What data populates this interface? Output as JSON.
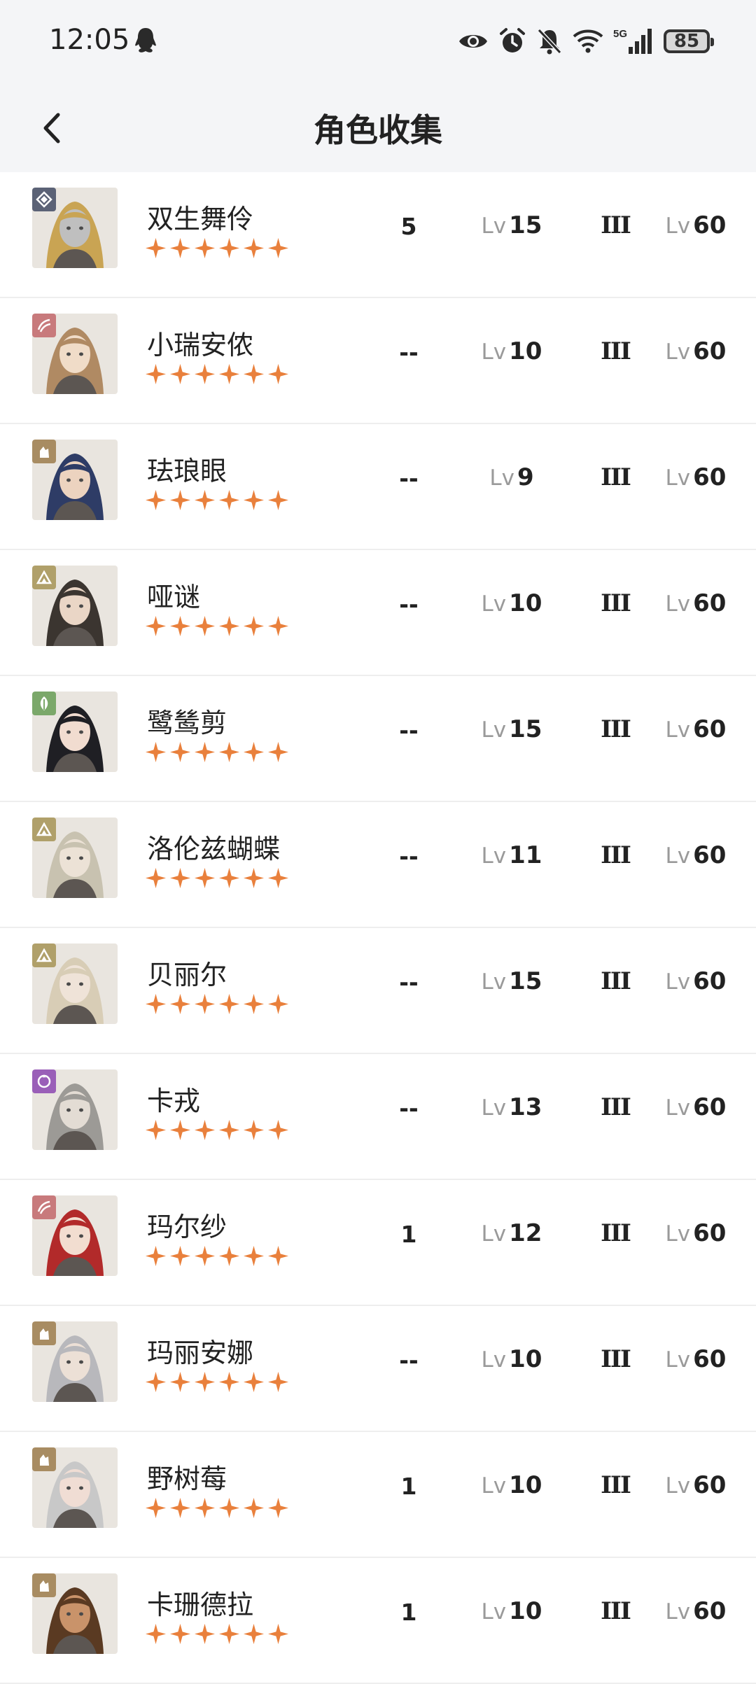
{
  "status_bar": {
    "time": "12:05",
    "battery": "85",
    "network": "5G",
    "icons": [
      "qq-icon",
      "eye-icon",
      "alarm-icon",
      "mute-icon",
      "wifi-icon",
      "signal-icon",
      "battery-icon"
    ]
  },
  "app_bar": {
    "title": "角色收集",
    "back_icon": "chevron-left-icon"
  },
  "colors": {
    "star": "#e9803c",
    "background_header": "#f4f5f7",
    "divider": "#eeeeee"
  },
  "characters": [
    {
      "name": "双生舞伶",
      "stars": 6,
      "count": "5",
      "lv_label": "Lv",
      "level": "15",
      "rank": "III",
      "max_label": "Lv",
      "max_level": "60",
      "element": "purple-diamond",
      "badge_color": "#5b6276",
      "hair": "#c9a453",
      "skin": "#bfbfbf"
    },
    {
      "name": "小瑞安侬",
      "stars": 6,
      "count": "--",
      "lv_label": "Lv",
      "level": "10",
      "rank": "III",
      "max_label": "Lv",
      "max_level": "60",
      "element": "wind",
      "badge_color": "#c87a7c",
      "hair": "#b08a63",
      "skin": "#f0dcc8"
    },
    {
      "name": "珐琅眼",
      "stars": 6,
      "count": "--",
      "lv_label": "Lv",
      "level": "9",
      "rank": "III",
      "max_label": "Lv",
      "max_level": "60",
      "element": "beast",
      "badge_color": "#a88c62",
      "hair": "#2e3c66",
      "skin": "#ecd3bf"
    },
    {
      "name": "哑谜",
      "stars": 6,
      "count": "--",
      "lv_label": "Lv",
      "level": "10",
      "rank": "III",
      "max_label": "Lv",
      "max_level": "60",
      "element": "rock",
      "badge_color": "#b0a06a",
      "hair": "#3b3530",
      "skin": "#ead6c6"
    },
    {
      "name": "鹭鸶剪",
      "stars": 6,
      "count": "--",
      "lv_label": "Lv",
      "level": "15",
      "rank": "III",
      "max_label": "Lv",
      "max_level": "60",
      "element": "plant",
      "badge_color": "#7ba86a",
      "hair": "#1f1f24",
      "skin": "#f1dcd0"
    },
    {
      "name": "洛伦兹蝴蝶",
      "stars": 6,
      "count": "--",
      "lv_label": "Lv",
      "level": "11",
      "rank": "III",
      "max_label": "Lv",
      "max_level": "60",
      "element": "rock",
      "badge_color": "#b0a06a",
      "hair": "#c8c2b0",
      "skin": "#ece2d6"
    },
    {
      "name": "贝丽尔",
      "stars": 6,
      "count": "--",
      "lv_label": "Lv",
      "level": "15",
      "rank": "III",
      "max_label": "Lv",
      "max_level": "60",
      "element": "rock",
      "badge_color": "#b0a06a",
      "hair": "#d8cdb6",
      "skin": "#efe3d8"
    },
    {
      "name": "卡戎",
      "stars": 6,
      "count": "--",
      "lv_label": "Lv",
      "level": "13",
      "rank": "III",
      "max_label": "Lv",
      "max_level": "60",
      "element": "star",
      "badge_color": "#9a5fb8",
      "hair": "#9c9a96",
      "skin": "#e3dcd4"
    },
    {
      "name": "玛尔纱",
      "stars": 6,
      "count": "1",
      "lv_label": "Lv",
      "level": "12",
      "rank": "III",
      "max_label": "Lv",
      "max_level": "60",
      "element": "wind",
      "badge_color": "#c87a7c",
      "hair": "#b22a2a",
      "skin": "#f2ddd0"
    },
    {
      "name": "玛丽安娜",
      "stars": 6,
      "count": "--",
      "lv_label": "Lv",
      "level": "10",
      "rank": "III",
      "max_label": "Lv",
      "max_level": "60",
      "element": "beast",
      "badge_color": "#a88c62",
      "hair": "#b8b8bc",
      "skin": "#ece0d6"
    },
    {
      "name": "野树莓",
      "stars": 6,
      "count": "1",
      "lv_label": "Lv",
      "level": "10",
      "rank": "III",
      "max_label": "Lv",
      "max_level": "60",
      "element": "beast",
      "badge_color": "#a88c62",
      "hair": "#c8c8c8",
      "skin": "#f0ddd4"
    },
    {
      "name": "卡珊德拉",
      "stars": 6,
      "count": "1",
      "lv_label": "Lv",
      "level": "10",
      "rank": "III",
      "max_label": "Lv",
      "max_level": "60",
      "element": "beast",
      "badge_color": "#a88c62",
      "hair": "#5a3a22",
      "skin": "#c9936a"
    }
  ]
}
